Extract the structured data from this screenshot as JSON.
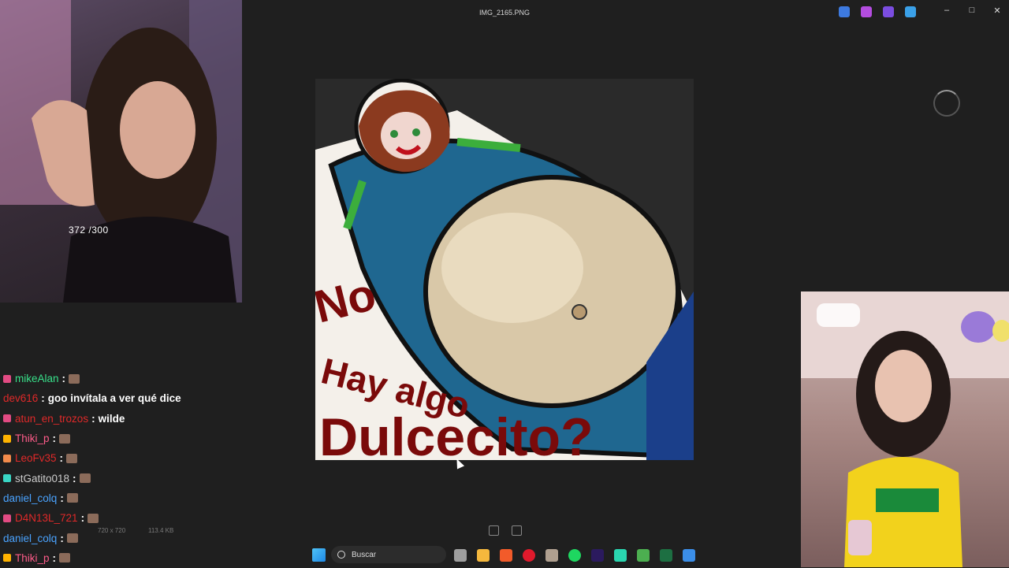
{
  "window": {
    "title": "IMG_2165.PNG",
    "controls": [
      "minimize-icon",
      "maximize-icon",
      "close-icon"
    ],
    "toolbar_icons": [
      "edit-icon",
      "copilot-icon",
      "clipchamp-icon",
      "onedrive-icon"
    ]
  },
  "stream": {
    "counter": "372  /300"
  },
  "picture": {
    "text_line1": "No",
    "text_line2": "Hay algo",
    "text_line3": "Dulcecito?",
    "colors": {
      "background": "#2a2a2a",
      "shirt": "#1f6790",
      "belly": "#d9c8a8",
      "pants": "#1b3f8a",
      "hair": "#8b3a1f",
      "text": "#7a0a0a"
    }
  },
  "chat": {
    "messages": [
      {
        "user": "mikeAlan",
        "color": "#38e08a",
        "text": "",
        "badge": "#e24b83",
        "emote": true
      },
      {
        "user": "dev616",
        "color": "#e02929",
        "text": "goo invítala a ver qué dice",
        "badge": "",
        "emote": false
      },
      {
        "user": "atun_en_trozos",
        "color": "#e02929",
        "text": "wilde",
        "badge": "#e24b83",
        "emote": false
      },
      {
        "user": "Thiki_p",
        "color": "#ff5c8a",
        "text": "",
        "badge": "#ffb300",
        "emote": true
      },
      {
        "user": "LeoFv35",
        "color": "#e02929",
        "text": "",
        "badge": "#f28b4b",
        "emote": true
      },
      {
        "user": "stGatito018",
        "color": "#cccccc",
        "text": "",
        "badge": "#39d6c4",
        "emote": true
      },
      {
        "user": "daniel_colq",
        "color": "#4aa3ff",
        "text": "",
        "badge": "",
        "emote": true
      },
      {
        "user": "D4N13L_721",
        "color": "#e02929",
        "text": "",
        "badge": "#e24b83",
        "emote": true
      },
      {
        "user": "daniel_colq",
        "color": "#4aa3ff",
        "text": "",
        "badge": "",
        "emote": true
      },
      {
        "user": "Thiki_p",
        "color": "#ff5c8a",
        "text": "",
        "badge": "#ffb300",
        "emote": true
      }
    ]
  },
  "info_bar": {
    "dimensions": "720 x 720",
    "file_size": "113.4 KB"
  },
  "taskbar": {
    "search_placeholder": "Buscar",
    "apps": [
      {
        "name": "task-view-icon",
        "color": "#9e9e9e"
      },
      {
        "name": "file-explorer-icon",
        "color": "#f5b83d"
      },
      {
        "name": "brave-icon",
        "color": "#f25b2a"
      },
      {
        "name": "opera-icon",
        "color": "#e01a2c"
      },
      {
        "name": "streaming-app-icon",
        "color": "#b0a090"
      },
      {
        "name": "spotify-icon",
        "color": "#1ed760"
      },
      {
        "name": "premiere-icon",
        "color": "#2b1a5e"
      },
      {
        "name": "line-icon",
        "color": "#2ad6b0"
      },
      {
        "name": "notepad-icon",
        "color": "#4caf50"
      },
      {
        "name": "excel-icon",
        "color": "#1d6f42"
      },
      {
        "name": "photos-icon",
        "color": "#3b8ee8"
      }
    ]
  }
}
